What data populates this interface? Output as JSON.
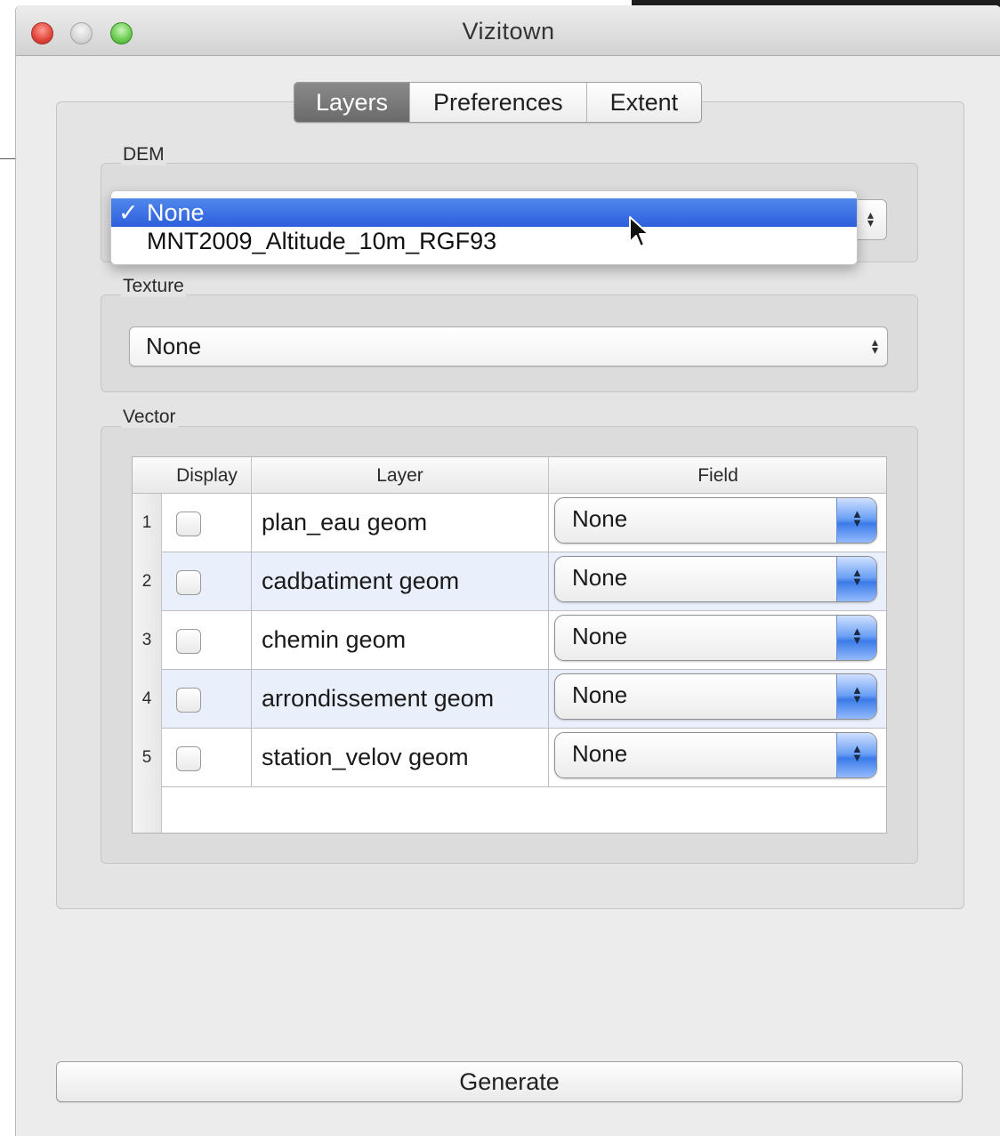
{
  "window": {
    "title": "Vizitown"
  },
  "tabs": [
    {
      "label": "Layers",
      "active": true
    },
    {
      "label": "Preferences",
      "active": false
    },
    {
      "label": "Extent",
      "active": false
    }
  ],
  "dem": {
    "title": "DEM",
    "dropdown_open": true,
    "options": [
      {
        "label": "None",
        "checkmark": "✓",
        "selected": true
      },
      {
        "label": "MNT2009_Altitude_10m_RGF93",
        "selected": false
      }
    ]
  },
  "texture": {
    "title": "Texture",
    "value": "None"
  },
  "vector": {
    "title": "Vector",
    "columns": {
      "display": "Display",
      "layer": "Layer",
      "field": "Field"
    },
    "rows": [
      {
        "num": "1",
        "layer": "plan_eau geom",
        "field": "None",
        "display": false
      },
      {
        "num": "2",
        "layer": "cadbatiment geom",
        "field": "None",
        "display": false
      },
      {
        "num": "3",
        "layer": "chemin geom",
        "field": "None",
        "display": false
      },
      {
        "num": "4",
        "layer": "arrondissement geom",
        "field": "None",
        "display": false
      },
      {
        "num": "5",
        "layer": "station_velov geom",
        "field": "None",
        "display": false
      }
    ]
  },
  "generate_label": "Generate",
  "colors": {
    "menu_highlight": "#3a6ee6",
    "active_tab": "#7a7a7a",
    "spinner_blue": "#4f8cf0"
  }
}
